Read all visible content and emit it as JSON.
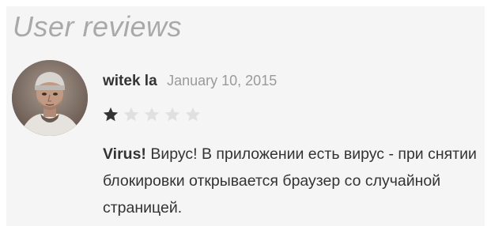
{
  "section": {
    "title": "User reviews"
  },
  "review": {
    "author": "witek la",
    "date": "January 10, 2015",
    "rating": 1,
    "max_rating": 5,
    "title": "Virus!",
    "text": "Вирус! В приложении есть вирус - при снятии блокировки открывается браузер со случайной страницей."
  },
  "colors": {
    "star_filled": "#333333",
    "star_empty": "#e0e0e0",
    "title_gray": "#a9a9a9",
    "date_gray": "#9a9a9a",
    "panel_bg": "#f5f5f5"
  },
  "icons": {
    "avatar": "user-avatar-photo",
    "star": "star-icon"
  }
}
